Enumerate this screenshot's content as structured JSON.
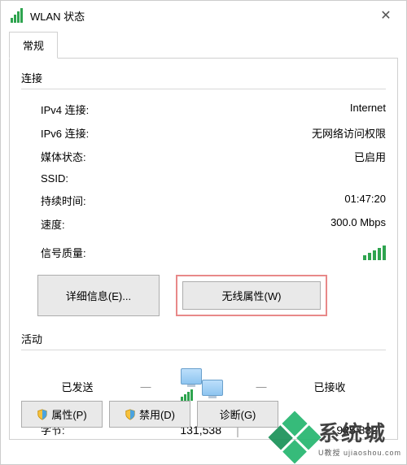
{
  "window": {
    "title": "WLAN 状态"
  },
  "tabs": {
    "general": "常规"
  },
  "connection": {
    "section_title": "连接",
    "rows": {
      "ipv4_label": "IPv4 连接:",
      "ipv4_value": "Internet",
      "ipv6_label": "IPv6 连接:",
      "ipv6_value": "无网络访问权限",
      "media_label": "媒体状态:",
      "media_value": "已启用",
      "ssid_label": "SSID:",
      "ssid_value": "    ",
      "duration_label": "持续时间:",
      "duration_value": "01:47:20",
      "speed_label": "速度:",
      "speed_value": "300.0 Mbps",
      "signal_label": "信号质量:"
    }
  },
  "buttons": {
    "details": "详细信息(E)...",
    "wireless_props": "无线属性(W)"
  },
  "activity": {
    "section_title": "活动",
    "sent_label": "已发送",
    "recv_label": "已接收",
    "bytes_label": "字节:",
    "bytes_sent": "131,538",
    "bytes_recv": "945,882"
  },
  "bottom": {
    "properties": "属性(P)",
    "disable": "禁用(D)",
    "diagnose": "诊断(G)"
  },
  "watermark": {
    "name": "系统城",
    "sub": "U教授 ujiaoshou.com"
  }
}
